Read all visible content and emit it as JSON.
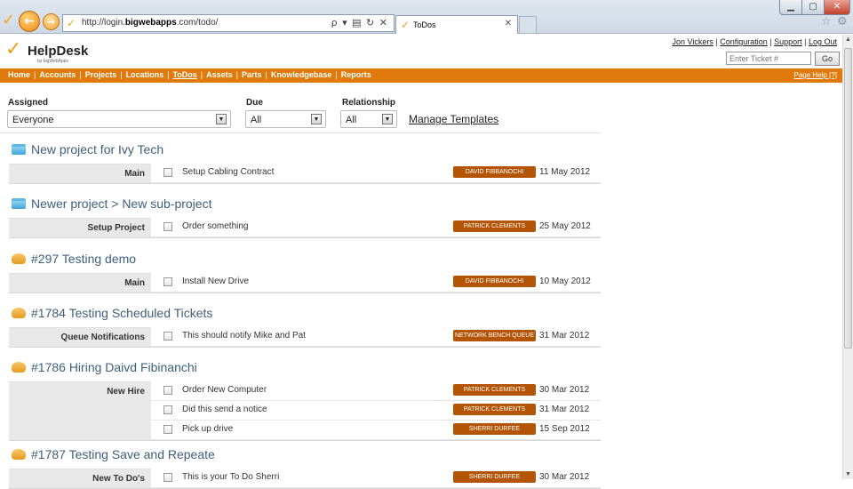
{
  "browser": {
    "url_prefix": "http://login.",
    "url_bold": "bigwebapps",
    "url_suffix": ".com/todo/",
    "tab_title": "ToDos",
    "address_tools": "ρ ▾ ▤ ↻ ✕"
  },
  "header": {
    "logo_name": "HelpDesk",
    "logo_by": "by bigWebApps",
    "user_link": "Jon Vickers",
    "config_link": "Configuration",
    "support_link": "Support",
    "logout_link": "Log Out",
    "ticket_placeholder": "Enter Ticket #",
    "go_label": "Go"
  },
  "nav": {
    "items": [
      "Home",
      "Accounts",
      "Projects",
      "Locations",
      "ToDos",
      "Assets",
      "Parts",
      "Knowledgebase",
      "Reports"
    ],
    "active": "ToDos",
    "page_help": "Page Help [?]"
  },
  "filters": {
    "assigned_label": "Assigned",
    "assigned_value": "Everyone",
    "due_label": "Due",
    "due_value": "All",
    "relationship_label": "Relationship",
    "relationship_value": "All",
    "manage_templates": "Manage Templates"
  },
  "groups": [
    {
      "title": "New project for Ivy Tech",
      "icon": "folder-icon",
      "category": "Main",
      "tasks": [
        {
          "text": "Setup Cabling Contract",
          "assignee": "DAVID FIBBANOCHI",
          "date": "11 May 2012"
        }
      ]
    },
    {
      "title": "Newer project > New sub-project",
      "icon": "folder-icon",
      "category": "Setup Project",
      "tasks": [
        {
          "text": "Order something",
          "assignee": "PATRICK CLEMENTS",
          "date": "25 May 2012"
        }
      ]
    },
    {
      "title": "#297 Testing demo",
      "icon": "ticket-icon",
      "category": "Main",
      "tasks": [
        {
          "text": "Install New Drive",
          "assignee": "DAVID FIBBANOCHI",
          "date": "10 May 2012"
        }
      ]
    },
    {
      "title": "#1784 Testing Scheduled Tickets",
      "icon": "ticket-icon",
      "category": "Queue Notifications",
      "tasks": [
        {
          "text": "This should notify Mike and Pat",
          "assignee": "NETWORK BENCH QUEUE",
          "date": "31 Mar 2012"
        }
      ]
    },
    {
      "title": "#1786 Hiring Daivd Fibinanchi",
      "icon": "ticket-icon",
      "category": "New Hire",
      "tasks": [
        {
          "text": "Order New Computer",
          "assignee": "PATRICK CLEMENTS",
          "date": "30 Mar 2012"
        },
        {
          "text": "Did this send a notice",
          "assignee": "PATRICK CLEMENTS",
          "date": "31 Mar 2012"
        },
        {
          "text": "Pick up drive",
          "assignee": "SHERRI DURFEE",
          "date": "15 Sep 2012"
        }
      ]
    },
    {
      "title": "#1787 Testing Save and Repeate",
      "icon": "ticket-icon",
      "category": "New To Do's",
      "tasks": [
        {
          "text": "This is your To Do Sherri",
          "assignee": "SHERRI DURFEE",
          "date": "30 Mar 2012"
        }
      ]
    }
  ]
}
